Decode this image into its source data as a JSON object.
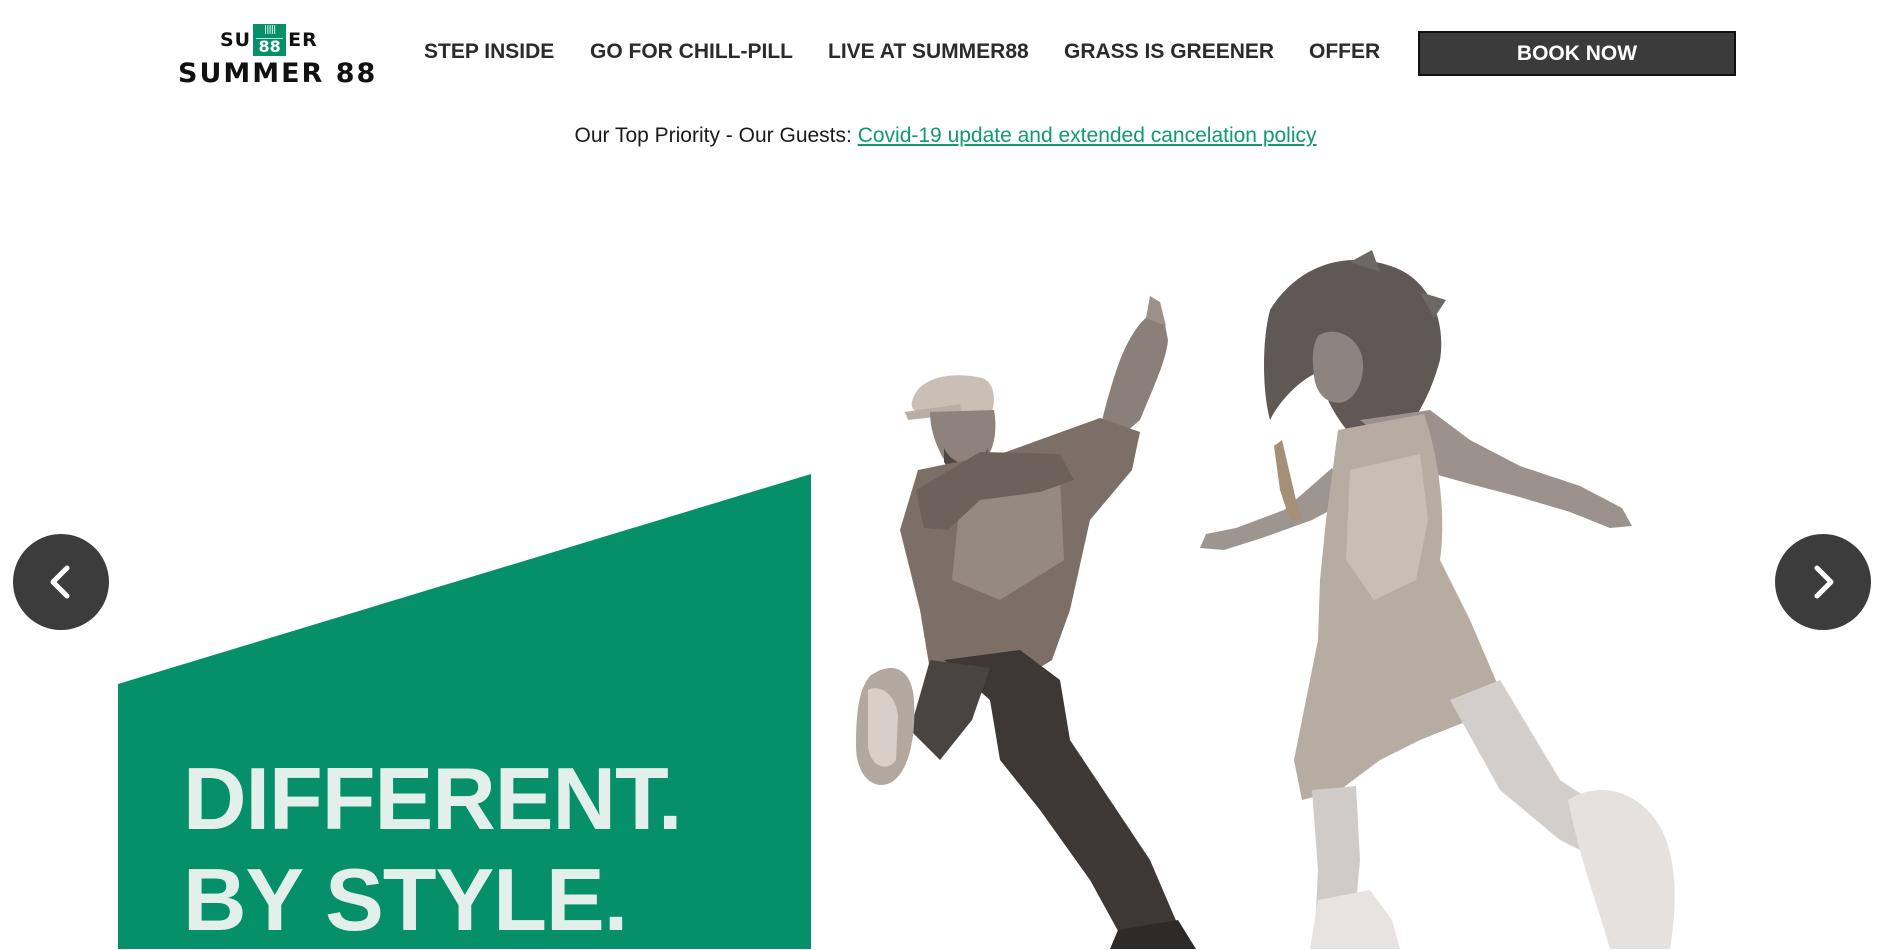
{
  "logo": {
    "top_left": "SU",
    "top_right": "ER",
    "badge": "88",
    "name": "SUMMER 88"
  },
  "nav": {
    "items": [
      {
        "label": "STEP INSIDE"
      },
      {
        "label": "GO FOR CHILL-PILL"
      },
      {
        "label": "LIVE AT SUMMER88"
      },
      {
        "label": "GRASS IS GREENER"
      },
      {
        "label": "OFFER"
      }
    ],
    "book_label": "BOOK NOW"
  },
  "notice": {
    "text": "Our Top Priority - Our Guests: ",
    "link": "Covid-19 update and extended cancelation policy"
  },
  "hero": {
    "line1": "DIFFERENT.",
    "line2": "BY STYLE."
  },
  "slider": {
    "prev_icon": "chevron-left-icon",
    "next_icon": "chevron-right-icon"
  },
  "colors": {
    "brand_green": "#06906a",
    "link_green": "#119a72",
    "dark_button": "#3c3b3c",
    "arrow_bg": "#3d3c3d",
    "headline_text": "#e3efeb"
  }
}
